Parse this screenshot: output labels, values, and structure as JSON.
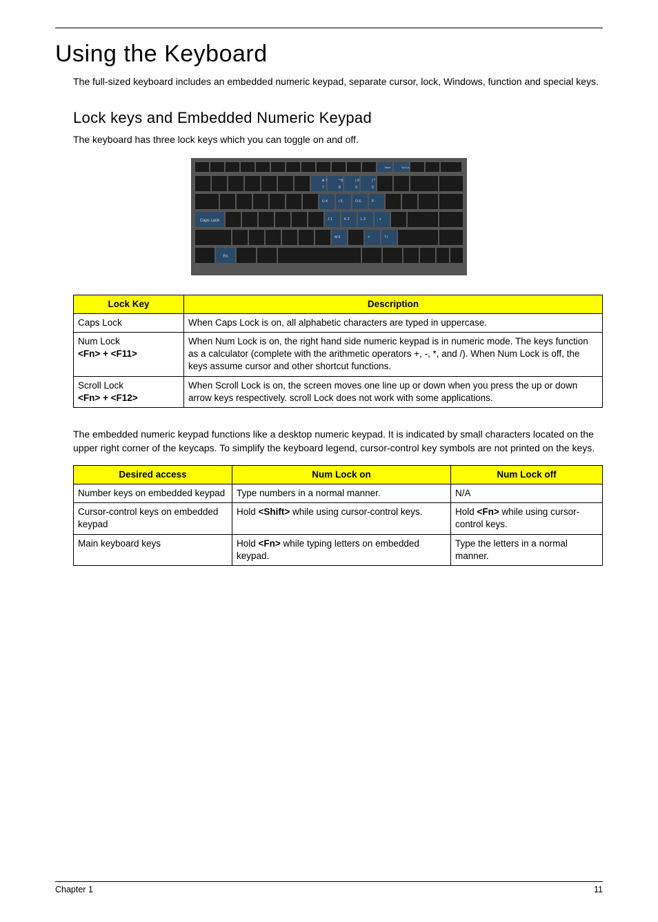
{
  "title": "Using the Keyboard",
  "intro": "The full-sized keyboard includes an embedded numeric keypad, separate cursor, lock, Windows, function and special keys.",
  "section1": {
    "heading": "Lock keys and Embedded Numeric Keypad",
    "text": "The keyboard has three lock keys which you can toggle on and off."
  },
  "table1": {
    "headers": {
      "lockkey": "Lock Key",
      "description": "Description"
    },
    "rows": [
      {
        "lockkey": "Caps Lock",
        "desc": "When Caps Lock is on, all alphabetic characters are typed in uppercase."
      },
      {
        "lockkey_line1": "Num Lock",
        "lockkey_line2": "<Fn> + <F11>",
        "desc": "When Num Lock is on, the right hand side numeric keypad is in numeric mode. The keys function as a calculator (complete with the arithmetic operators +, -, *, and /). When Num Lock is off, the keys assume cursor and other shortcut functions."
      },
      {
        "lockkey_line1": "Scroll Lock",
        "lockkey_line2": "<Fn> + <F12>",
        "desc": "When Scroll Lock is on, the screen moves one line up or down when you press the up or down arrow keys respectively. scroll Lock does not work with some applications."
      }
    ]
  },
  "midtext": "The embedded numeric keypad functions like a desktop numeric keypad. It is indicated by small characters located on the upper right corner of the keycaps. To simplify the keyboard legend, cursor-control key symbols are not printed on the keys.",
  "table2": {
    "headers": {
      "access": "Desired access",
      "on": "Num Lock on",
      "off": "Num Lock off"
    },
    "rows": [
      {
        "access": "Number keys on embedded keypad",
        "on": "Type numbers in a normal manner.",
        "off": "N/A"
      },
      {
        "access": "Cursor-control keys on embedded keypad",
        "on_pre": "Hold ",
        "on_bold": "<Shift>",
        "on_post": " while using cursor-control keys.",
        "off_pre": "Hold ",
        "off_bold": "<Fn>",
        "off_post": " while using cursor-control keys."
      },
      {
        "access": "Main keyboard keys",
        "on_pre": "Hold ",
        "on_bold": "<Fn>",
        "on_post": " while typing letters on embedded keypad.",
        "off": "Type the letters in a normal manner."
      }
    ]
  },
  "footer": {
    "left": "Chapter 1",
    "right": "11"
  }
}
